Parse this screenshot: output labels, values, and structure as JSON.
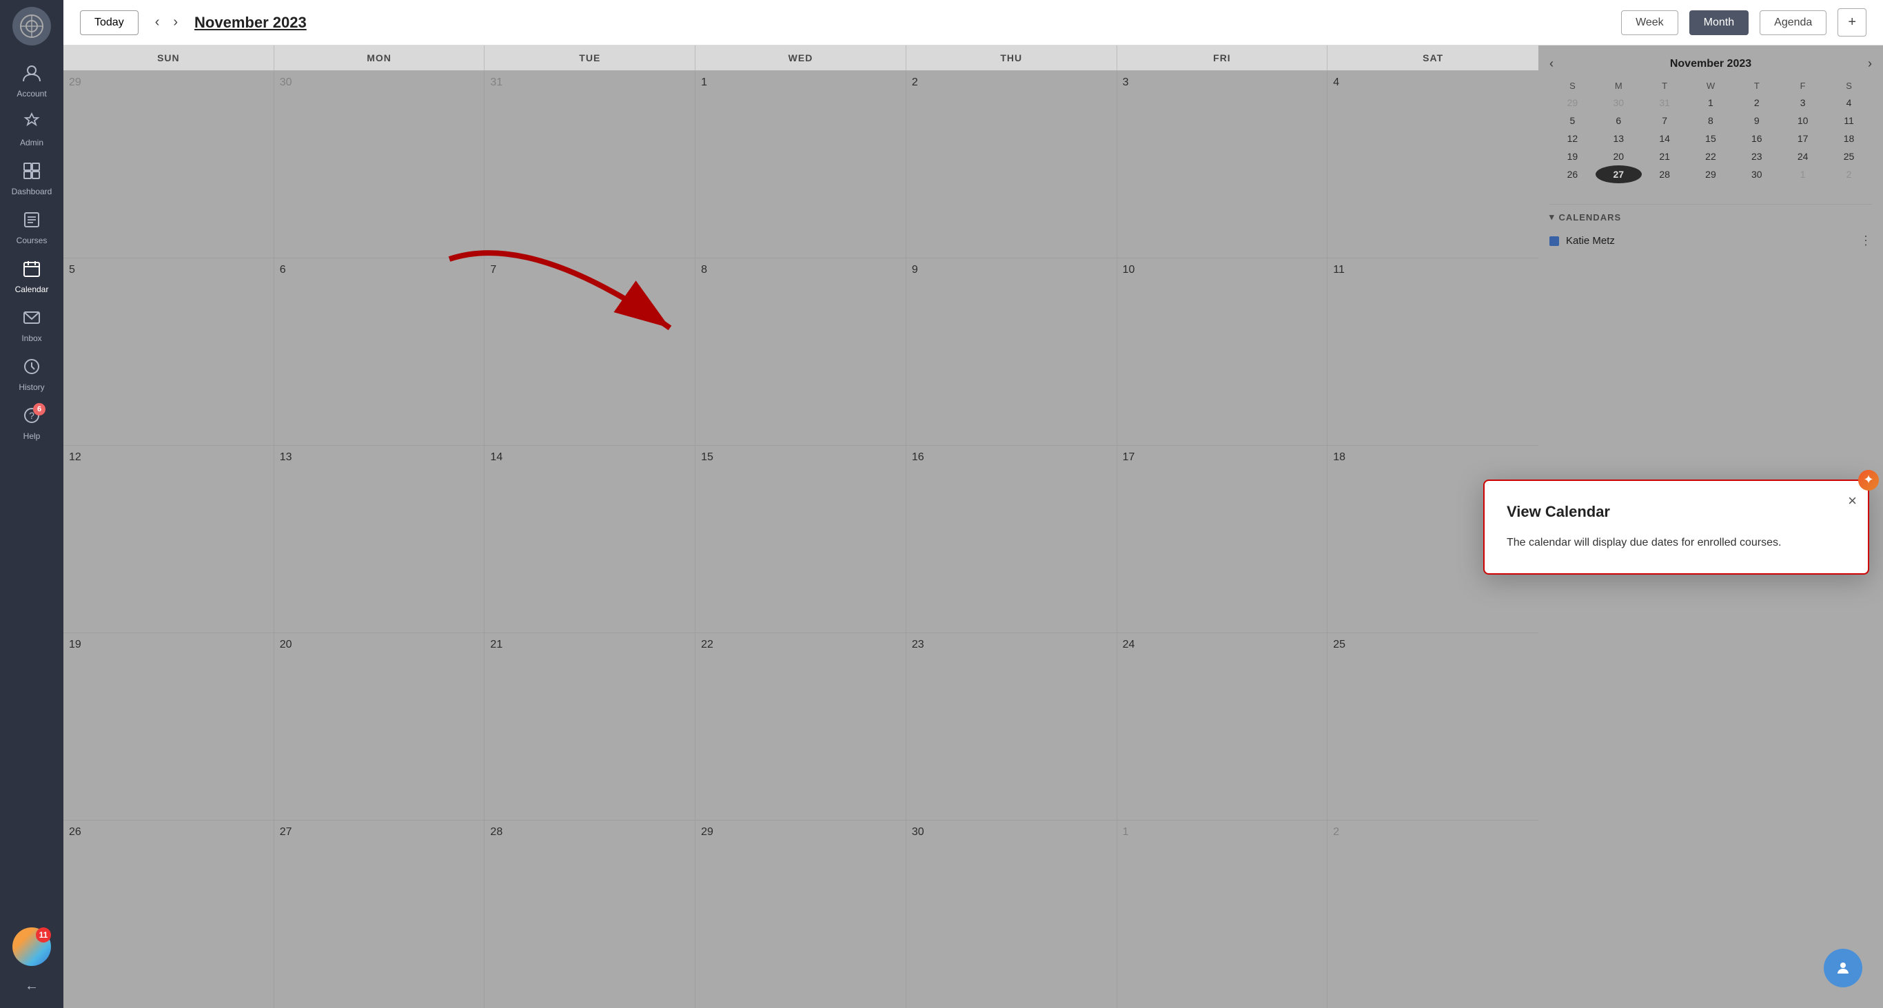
{
  "sidebar": {
    "items": [
      {
        "id": "account",
        "label": "Account",
        "icon": "👤"
      },
      {
        "id": "admin",
        "label": "Admin",
        "icon": "🔖"
      },
      {
        "id": "dashboard",
        "label": "Dashboard",
        "icon": "⊞"
      },
      {
        "id": "courses",
        "label": "Courses",
        "icon": "📋"
      },
      {
        "id": "calendar",
        "label": "Calendar",
        "icon": "📅",
        "active": true
      },
      {
        "id": "inbox",
        "label": "Inbox",
        "icon": "✉"
      },
      {
        "id": "history",
        "label": "History",
        "icon": "🕐"
      },
      {
        "id": "help",
        "label": "Help",
        "icon": "❓",
        "badge": "6"
      }
    ],
    "notification_count": "11",
    "collapse_label": "←"
  },
  "toolbar": {
    "today_label": "Today",
    "month_title": "November 2023",
    "views": [
      "Week",
      "Month",
      "Agenda"
    ],
    "active_view": "Month",
    "add_label": "+"
  },
  "calendar": {
    "day_headers": [
      "SUN",
      "MON",
      "TUE",
      "WED",
      "THU",
      "FRI",
      "SAT"
    ],
    "weeks": [
      [
        {
          "num": "29",
          "other": true
        },
        {
          "num": "30",
          "other": true
        },
        {
          "num": "31",
          "other": true
        },
        {
          "num": "1"
        },
        {
          "num": "2"
        },
        {
          "num": "3"
        },
        {
          "num": "4"
        }
      ],
      [
        {
          "num": "5"
        },
        {
          "num": "6"
        },
        {
          "num": "7"
        },
        {
          "num": "8"
        },
        {
          "num": "9"
        },
        {
          "num": "10"
        },
        {
          "num": "11"
        }
      ],
      [
        {
          "num": "12"
        },
        {
          "num": "13"
        },
        {
          "num": "14"
        },
        {
          "num": "15"
        },
        {
          "num": "16"
        },
        {
          "num": "17"
        },
        {
          "num": "18"
        }
      ],
      [
        {
          "num": "19"
        },
        {
          "num": "20"
        },
        {
          "num": "21"
        },
        {
          "num": "22"
        },
        {
          "num": "23"
        },
        {
          "num": "24"
        },
        {
          "num": "25"
        }
      ],
      [
        {
          "num": "26"
        },
        {
          "num": "27"
        },
        {
          "num": "28"
        },
        {
          "num": "29"
        },
        {
          "num": "30"
        },
        {
          "num": "1",
          "other": true
        },
        {
          "num": "2",
          "other": true
        }
      ]
    ]
  },
  "mini_calendar": {
    "title": "November 2023",
    "day_headers": [
      "S",
      "M",
      "T",
      "W",
      "T",
      "F",
      "S"
    ],
    "weeks": [
      [
        {
          "num": "29",
          "other": true
        },
        {
          "num": "30",
          "other": true
        },
        {
          "num": "31",
          "other": true
        },
        {
          "num": "1"
        },
        {
          "num": "2"
        },
        {
          "num": "3"
        },
        {
          "num": "4"
        }
      ],
      [
        {
          "num": "5"
        },
        {
          "num": "6"
        },
        {
          "num": "7"
        },
        {
          "num": "8"
        },
        {
          "num": "9"
        },
        {
          "num": "10"
        },
        {
          "num": "11"
        }
      ],
      [
        {
          "num": "12"
        },
        {
          "num": "13"
        },
        {
          "num": "14"
        },
        {
          "num": "15"
        },
        {
          "num": "16"
        },
        {
          "num": "17"
        },
        {
          "num": "18"
        }
      ],
      [
        {
          "num": "19"
        },
        {
          "num": "20"
        },
        {
          "num": "21"
        },
        {
          "num": "22"
        },
        {
          "num": "23"
        },
        {
          "num": "24"
        },
        {
          "num": "25"
        }
      ],
      [
        {
          "num": "26"
        },
        {
          "num": "27",
          "today": true
        },
        {
          "num": "28"
        },
        {
          "num": "29"
        },
        {
          "num": "30"
        },
        {
          "num": "1",
          "other": true
        },
        {
          "num": "2",
          "other": true
        }
      ]
    ]
  },
  "calendars_section": {
    "title": "CALENDARS",
    "items": [
      {
        "name": "Katie Metz",
        "color": "#4472c4"
      }
    ]
  },
  "modal": {
    "title": "View Calendar",
    "body": "The calendar will display due dates for enrolled courses.",
    "close_label": "×"
  }
}
